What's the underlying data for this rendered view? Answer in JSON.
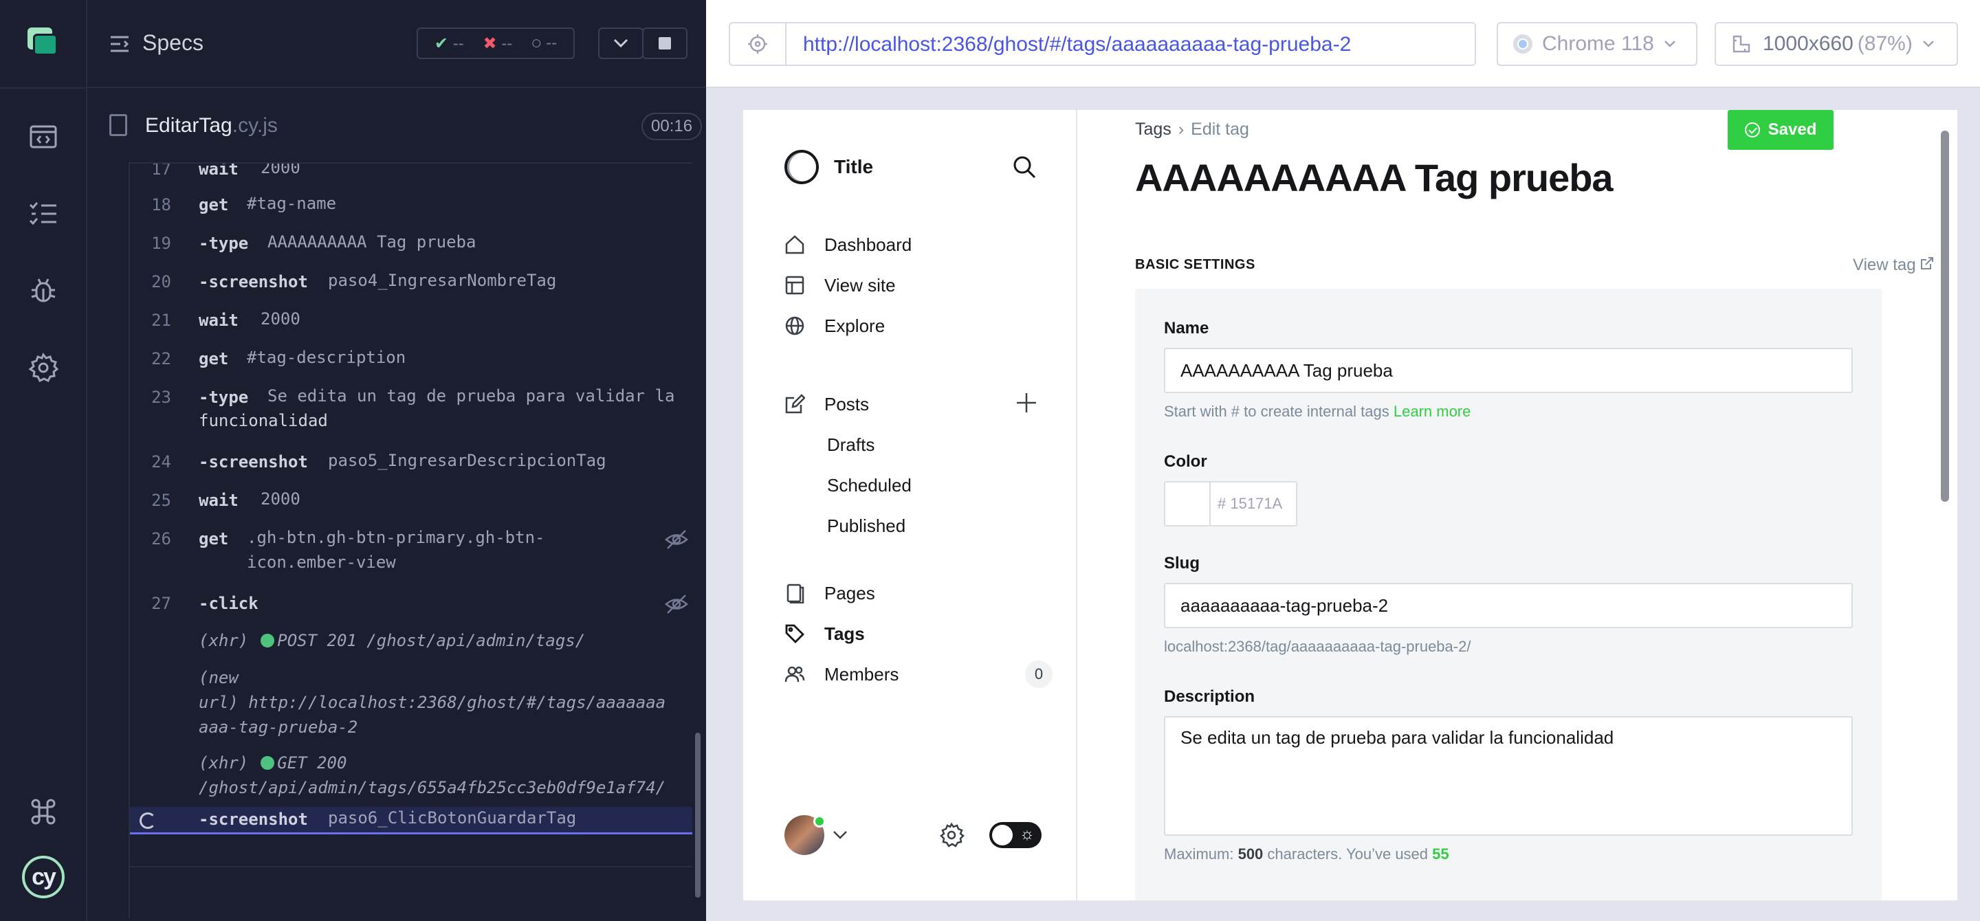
{
  "specs": {
    "title": "Specs",
    "passed": "--",
    "failed": "--",
    "pending": "--",
    "file_name": "EditarTag",
    "file_ext": ".cy.js",
    "timer": "00:16"
  },
  "commands": [
    {
      "num": "17",
      "name": "wait",
      "arg": "2000"
    },
    {
      "num": "18",
      "name": "get",
      "arg": "#tag-name"
    },
    {
      "num": "19",
      "name": "-type",
      "arg": "AAAAAAAAAA Tag prueba"
    },
    {
      "num": "20",
      "name": "-screenshot",
      "arg": "paso4_IngresarNombreTag"
    },
    {
      "num": "21",
      "name": "wait",
      "arg": "2000"
    },
    {
      "num": "22",
      "name": "get",
      "arg": "#tag-description"
    },
    {
      "num": "23",
      "name": "-type",
      "arg": "Se edita un tag de prueba para validar la",
      "arg2": "funcionalidad"
    },
    {
      "num": "24",
      "name": "-screenshot",
      "arg": "paso5_IngresarDescripcionTag"
    },
    {
      "num": "25",
      "name": "wait",
      "arg": "2000"
    },
    {
      "num": "26",
      "name": "get",
      "arg": ".gh-btn.gh-btn-primary.gh-btn-",
      "arg2": "icon.ember-view"
    },
    {
      "num": "27",
      "name": "-click",
      "arg": ""
    }
  ],
  "logs": [
    {
      "prefix": "(xhr)",
      "text": "POST 201 /ghost/api/admin/tags/"
    },
    {
      "prefix": "(new",
      "text": "url)  http://localhost:2368/ghost/#/tags/aaaaaaa",
      "line2": "aaa-tag-prueba-2"
    },
    {
      "prefix": "(xhr)",
      "text": "GET 200",
      "line2": "/ghost/api/admin/tags/655a4fb25cc3eb0df9e1af74/"
    }
  ],
  "active_command": {
    "name": "-screenshot",
    "arg": "paso6_ClicBotonGuardarTag"
  },
  "browser": {
    "url": "http://localhost:2368/ghost/#/tags/aaaaaaaaaa-tag-prueba-2",
    "name": "Chrome 118",
    "viewport": "1000x660",
    "zoom": "(87%)"
  },
  "ghost": {
    "site_title": "Title",
    "nav": {
      "dashboard": "Dashboard",
      "view_site": "View site",
      "explore": "Explore",
      "posts": "Posts",
      "drafts": "Drafts",
      "scheduled": "Scheduled",
      "published": "Published",
      "pages": "Pages",
      "tags": "Tags",
      "members": "Members",
      "members_count": "0"
    },
    "breadcrumb": {
      "parent": "Tags",
      "current": "Edit tag"
    },
    "saved_label": "Saved",
    "page_title": "AAAAAAAAAA Tag prueba",
    "section": "BASIC SETTINGS",
    "view_tag": "View tag",
    "form": {
      "name_label": "Name",
      "name_value": "AAAAAAAAAA Tag prueba",
      "name_hint": "Start with # to create internal tags",
      "learn_more": "Learn more",
      "color_label": "Color",
      "color_placeholder": "# 15171A",
      "slug_label": "Slug",
      "slug_value": "aaaaaaaaaa-tag-prueba-2",
      "slug_hint": "localhost:2368/tag/aaaaaaaaaa-tag-prueba-2/",
      "desc_label": "Description",
      "desc_value": "Se edita un tag de prueba para validar la funcionalidad",
      "desc_hint_prefix": "Maximum:",
      "desc_max": "500",
      "desc_hint_mid": "characters. You’ve used",
      "desc_used": "55"
    }
  },
  "colors": {
    "accent_green": "#30cf43",
    "url_blue": "#4956e3",
    "runner_bg": "#1b1e2e",
    "active_indigo": "#6b6ff0"
  }
}
